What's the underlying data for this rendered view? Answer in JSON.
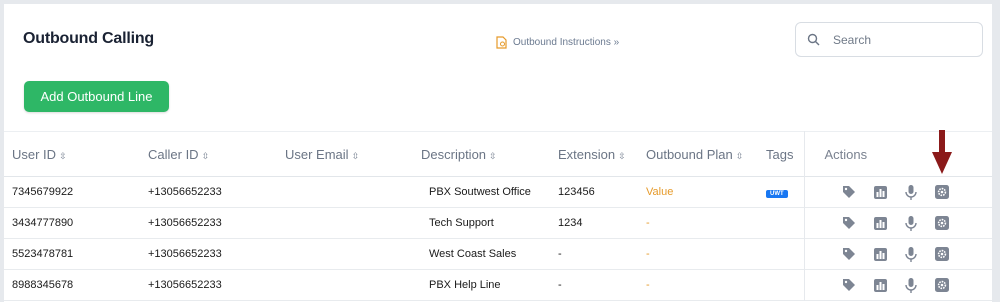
{
  "page": {
    "title": "Outbound Calling",
    "instructions_link": "Outbound Instructions »",
    "search_placeholder": "Search",
    "add_button": "Add Outbound Line"
  },
  "table": {
    "columns": [
      "User ID",
      "Caller ID",
      "User Email",
      "Description",
      "Extension",
      "Outbound Plan",
      "Tags",
      "Actions"
    ],
    "rows": [
      {
        "user_id": "7345679922",
        "caller_id": "+13056652233",
        "email": "",
        "description": "PBX Soutwest Office",
        "extension": "123456",
        "plan": "Value",
        "tag": "UWT"
      },
      {
        "user_id": "3434777890",
        "caller_id": "+13056652233",
        "email": "",
        "description": "Tech Support",
        "extension": "1234",
        "plan": "-",
        "tag": ""
      },
      {
        "user_id": "5523478781",
        "caller_id": "+13056652233",
        "email": "",
        "description": "West Coast Sales",
        "extension": "-",
        "plan": "-",
        "tag": ""
      },
      {
        "user_id": "8988345678",
        "caller_id": "+13056652233",
        "email": "",
        "description": "PBX Help Line",
        "extension": "-",
        "plan": "-",
        "tag": ""
      }
    ]
  },
  "icons": {
    "action_icons": [
      "tag-icon",
      "bar-chart-icon",
      "microphone-icon",
      "gear-icon"
    ],
    "icon_color": "#7d8593",
    "annotation_arrow_color": "#8b1a1a"
  },
  "colors": {
    "button_green": "#2eb766",
    "plan_orange": "#e69a2a",
    "tag_blue": "#1877f2"
  }
}
